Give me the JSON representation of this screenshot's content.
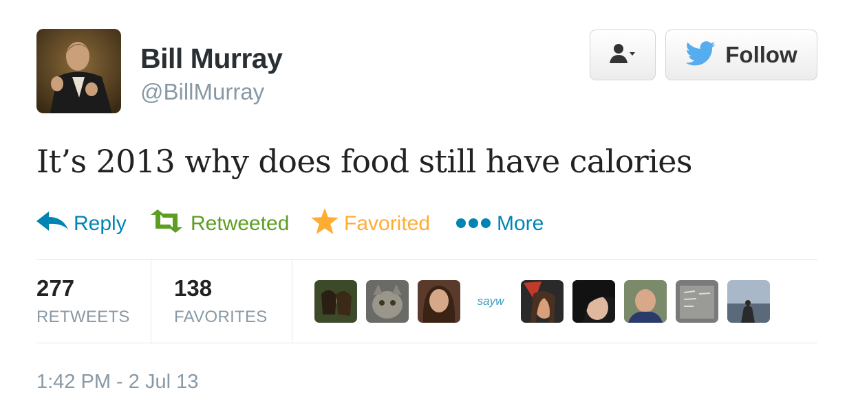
{
  "author": {
    "name": "Bill Murray",
    "handle": "@BillMurray"
  },
  "buttons": {
    "user_menu_icon": "user-dropdown-icon",
    "follow_label": "Follow",
    "follow_icon": "twitter-bird-icon"
  },
  "tweet": {
    "text": "It’s 2013 why does food still have calories",
    "timestamp": "1:42 PM - 2 Jul 13"
  },
  "actions": [
    {
      "label": "Reply",
      "icon": "reply-arrow-icon",
      "color": "#0084b4"
    },
    {
      "label": "Retweeted",
      "icon": "retweet-icon",
      "color": "#5c9e21"
    },
    {
      "label": "Favorited",
      "icon": "star-icon",
      "color": "#ffac33"
    },
    {
      "label": "More",
      "icon": "more-dots-icon",
      "color": "#0084b4"
    }
  ],
  "stats": {
    "retweets": {
      "count": "277",
      "label": "RETWEETS"
    },
    "favorites": {
      "count": "138",
      "label": "FAVORITES"
    }
  },
  "favoriters": [
    {
      "name": "favoriter-1"
    },
    {
      "name": "favoriter-2"
    },
    {
      "name": "favoriter-3"
    },
    {
      "name": "favoriter-4",
      "text": "sayw"
    },
    {
      "name": "favoriter-5"
    },
    {
      "name": "favoriter-6"
    },
    {
      "name": "favoriter-7"
    },
    {
      "name": "favoriter-8"
    },
    {
      "name": "favoriter-9"
    }
  ],
  "colors": {
    "link_blue": "#0084b4",
    "retweet_green": "#5c9e21",
    "favorite_orange": "#ffac33",
    "muted_gray": "#8899a6",
    "twitter_blue": "#55acee"
  }
}
